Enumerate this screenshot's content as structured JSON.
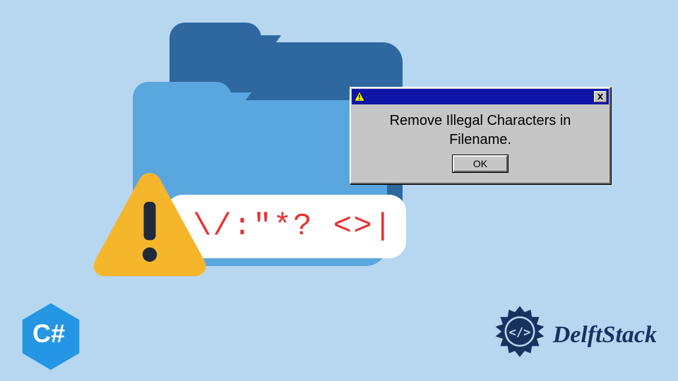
{
  "folder": {
    "filename_chars": "\\/:\"*? <>|"
  },
  "dialog": {
    "message_line1": "Remove Illegal Characters in",
    "message_line2": "Filename.",
    "ok_label": "OK"
  },
  "csharp": {
    "label": "C#"
  },
  "brand": {
    "name": "DelftStack"
  },
  "colors": {
    "bg": "#b7d7f0",
    "folder_back": "#2e689e",
    "folder_front": "#5aa6de",
    "warning": "#f5b62c",
    "warning_bang": "#1f2a3a",
    "error_text": "#e63232",
    "titlebar": "#1014a8",
    "brand": "#18325f"
  }
}
